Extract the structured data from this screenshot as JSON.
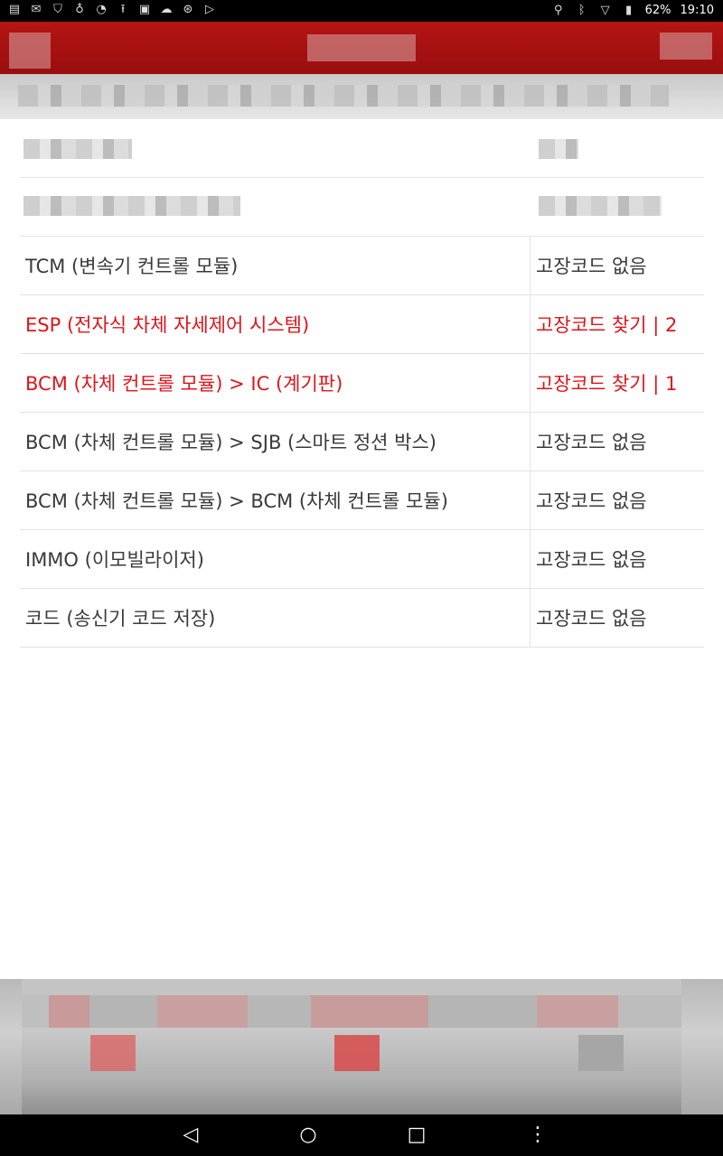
{
  "status_bar": {
    "battery": "62%",
    "time": "19:10",
    "left_icons": [
      "notes-icon",
      "gmail-icon",
      "shield-icon",
      "stethoscope-icon",
      "wifi-signal-icon",
      "upload-icon",
      "image-icon",
      "cloud-icon",
      "bluetooth-circle-icon",
      "play-store-icon"
    ],
    "right_icons": [
      "location-icon",
      "bluetooth-icon",
      "wifi-icon",
      "battery-icon"
    ]
  },
  "module_list": {
    "columns": [
      "module",
      "status"
    ],
    "rows": [
      {
        "module": "TCM (변속기 컨트롤 모듈)",
        "status": "고장코드 없음",
        "error": false
      },
      {
        "module": "ESP (전자식 차체 자세제어 시스템)",
        "status": "고장코드 찾기 | 2",
        "error": true
      },
      {
        "module": "BCM (차체 컨트롤 모듈) > IC (계기판)",
        "status": "고장코드 찾기 | 1",
        "error": true
      },
      {
        "module": "BCM (차체 컨트롤 모듈) > SJB (스마트 정션 박스)",
        "status": "고장코드 없음",
        "error": false
      },
      {
        "module": "BCM (차체 컨트롤 모듈) > BCM (차체 컨트롤 모듈)",
        "status": "고장코드 없음",
        "error": false
      },
      {
        "module": "IMMO (이모빌라이저)",
        "status": "고장코드 없음",
        "error": false
      },
      {
        "module": "코드 (송신기 코드 저장)",
        "status": "고장코드 없음",
        "error": false
      }
    ]
  },
  "colors": {
    "appbar_red": "#a81111",
    "error_red": "#e0141a",
    "text": "#3a3a3a"
  },
  "nav_bar": {
    "buttons": [
      "back-icon",
      "home-icon",
      "recents-icon",
      "menu-icon"
    ]
  }
}
